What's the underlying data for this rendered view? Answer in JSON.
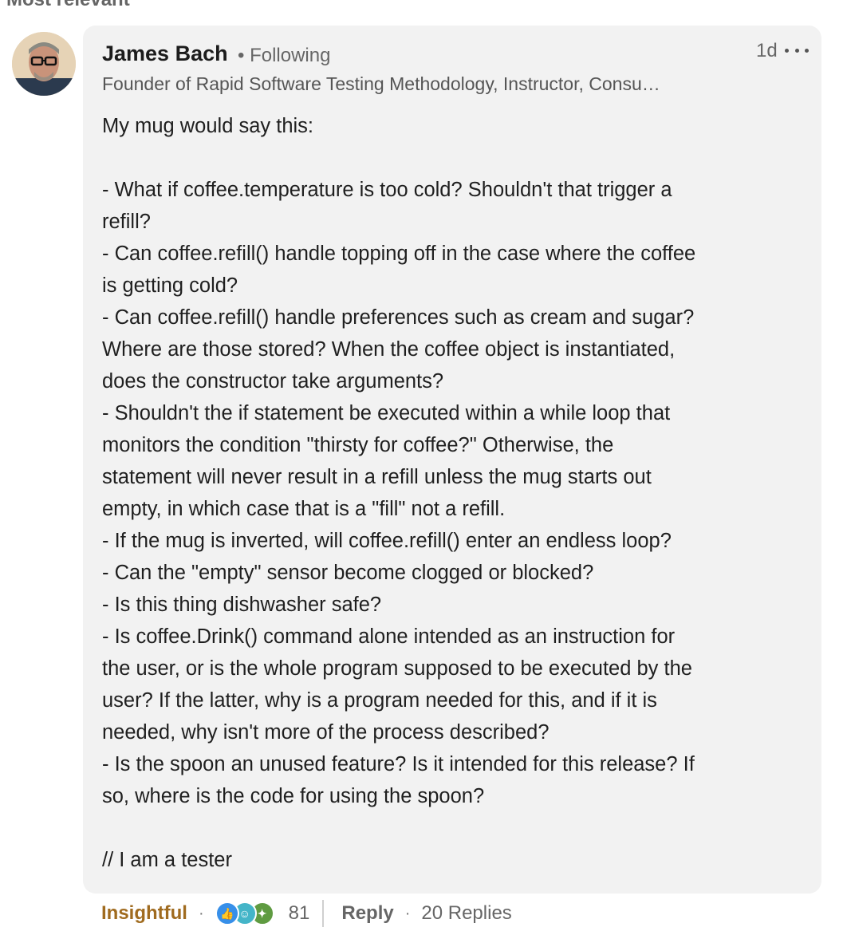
{
  "section_label": "Most relevant",
  "comment": {
    "author": "James Bach",
    "following": "• Following",
    "timestamp": "1d",
    "headline": "Founder of Rapid Software Testing Methodology, Instructor, Consu…",
    "lines": [
      "My mug would say this:",
      "",
      "- What if coffee.temperature is too cold? Shouldn't that trigger a",
      "refill?",
      "- Can coffee.refill() handle topping off in the case where the coffee",
      "is getting cold?",
      "- Can coffee.refill() handle preferences such as cream and sugar?",
      "Where are those stored? When the coffee object is instantiated,",
      "does the constructor take arguments?",
      "- Shouldn't the if statement be executed within a while loop that",
      "monitors the condition \"thirsty for coffee?\" Otherwise, the",
      "statement will never result in a refill unless the mug starts out",
      "empty, in which case that is a \"fill\" not a refill.",
      "- If the mug is inverted, will coffee.refill() enter an endless loop?",
      "- Can the \"empty\" sensor become clogged or blocked?",
      "- Is this thing dishwasher safe?",
      "- Is coffee.Drink() command alone intended as an instruction for",
      "the user, or is the whole program supposed to be executed by the",
      "user? If the latter, why is a program needed for this, and if it is",
      "needed, why isn't more of the process described?",
      "- Is the spoon an unused feature? Is it intended for this release? If",
      "so, where is the code for using the spoon?",
      "",
      "// I am a tester"
    ]
  },
  "footer": {
    "reaction_label": "Insightful",
    "dot": "·",
    "reaction_count": "81",
    "reply_label": "Reply",
    "replies_label": "20 Replies",
    "reaction_icons": [
      "like-icon",
      "funny-icon",
      "insightful-icon"
    ]
  },
  "colors": {
    "bubble": "#f2f2f2",
    "insightful": "#a06b1f",
    "muted": "#666666"
  }
}
